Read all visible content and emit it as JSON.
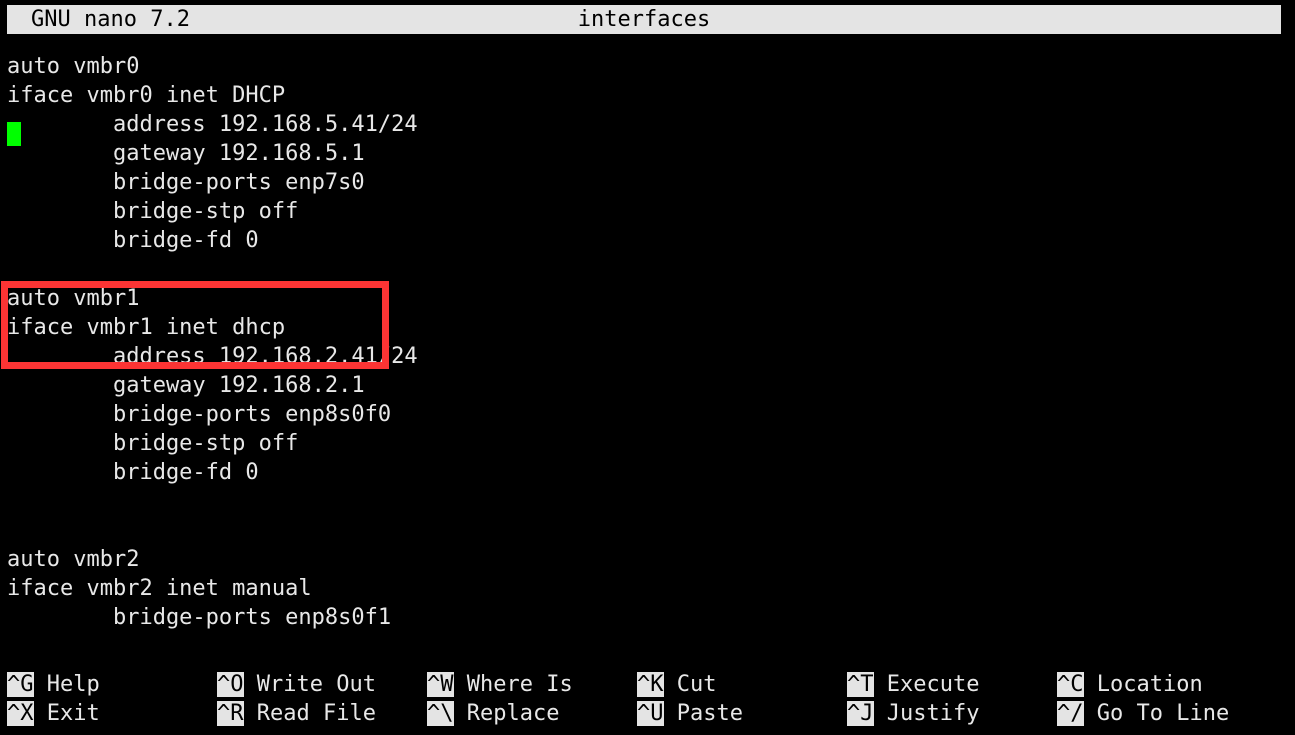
{
  "titlebar": {
    "version": "GNU nano 7.2",
    "filename": "interfaces"
  },
  "editor": {
    "cursor": {
      "line": 2,
      "column": 0,
      "color": "#00ff00"
    },
    "lines": [
      "auto vmbr0",
      "iface vmbr0 inet DHCP",
      "        address 192.168.5.41/24",
      "        gateway 192.168.5.1",
      "        bridge-ports enp7s0",
      "        bridge-stp off",
      "        bridge-fd 0",
      "",
      "auto vmbr1",
      "iface vmbr1 inet dhcp",
      "        address 192.168.2.41/24",
      "        gateway 192.168.2.1",
      "        bridge-ports enp8s0f0",
      "        bridge-stp off",
      "        bridge-fd 0",
      "",
      "",
      "auto vmbr2",
      "iface vmbr2 inet manual",
      "        bridge-ports enp8s0f1"
    ]
  },
  "annotation": {
    "highlight_color": "#fc3434",
    "highlighted_lines": [
      "auto vmbr1",
      "iface vmbr1 inet dhcp"
    ]
  },
  "helpbar": {
    "shortcuts": [
      {
        "key": "^G",
        "label": "Help",
        "col": 0,
        "row": 0
      },
      {
        "key": "^X",
        "label": "Exit",
        "col": 0,
        "row": 1
      },
      {
        "key": "^O",
        "label": "Write Out",
        "col": 1,
        "row": 0
      },
      {
        "key": "^R",
        "label": "Read File",
        "col": 1,
        "row": 1
      },
      {
        "key": "^W",
        "label": "Where Is",
        "col": 2,
        "row": 0
      },
      {
        "key": "^\\",
        "label": "Replace",
        "col": 2,
        "row": 1
      },
      {
        "key": "^K",
        "label": "Cut",
        "col": 3,
        "row": 0
      },
      {
        "key": "^U",
        "label": "Paste",
        "col": 3,
        "row": 1
      },
      {
        "key": "^T",
        "label": "Execute",
        "col": 4,
        "row": 0
      },
      {
        "key": "^J",
        "label": "Justify",
        "col": 4,
        "row": 1
      },
      {
        "key": "^C",
        "label": "Location",
        "col": 5,
        "row": 0
      },
      {
        "key": "^/",
        "label": "Go To Line",
        "col": 5,
        "row": 1
      }
    ]
  }
}
